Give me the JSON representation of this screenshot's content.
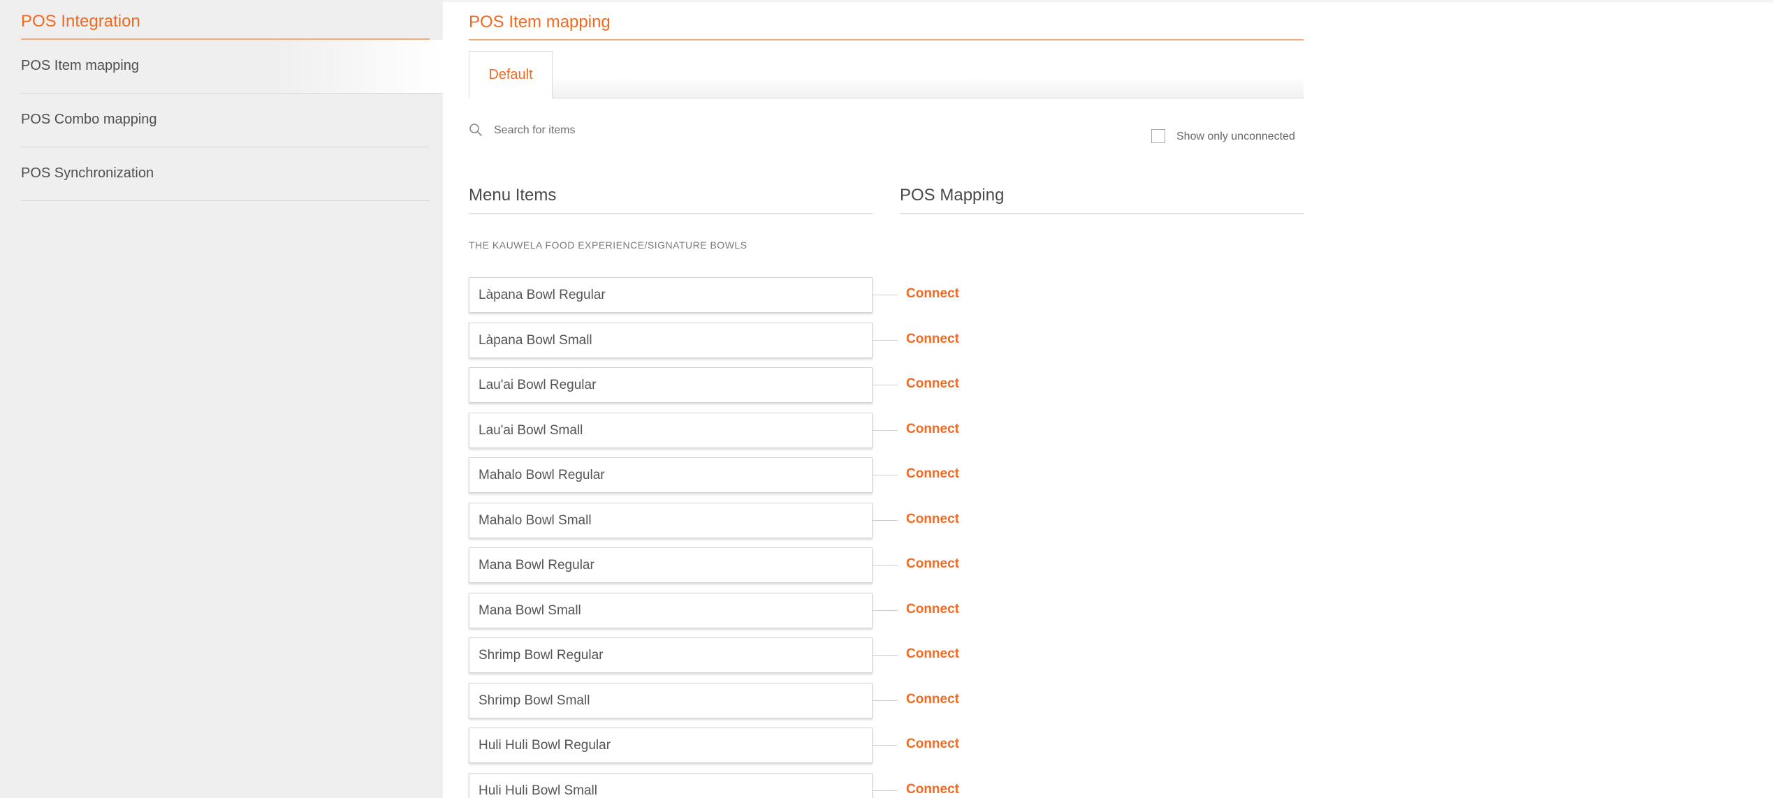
{
  "sidebar": {
    "title": "POS Integration",
    "items": [
      {
        "label": "POS Item mapping"
      },
      {
        "label": "POS Combo mapping"
      },
      {
        "label": "POS Synchronization"
      }
    ]
  },
  "main": {
    "title": "POS Item mapping",
    "tabs": [
      {
        "label": "Default"
      }
    ],
    "search": {
      "placeholder": "Search for items",
      "value": ""
    },
    "filter": {
      "label": "Show only unconnected",
      "checked": false
    },
    "columns": {
      "menu_items": "Menu Items",
      "pos_mapping": "POS Mapping"
    },
    "category": "THE KAUWELA FOOD EXPERIENCE/SIGNATURE BOWLS",
    "items": [
      {
        "name": "Làpana Bowl Regular",
        "action": "Connect"
      },
      {
        "name": "Làpana Bowl Small",
        "action": "Connect"
      },
      {
        "name": "Lau'ai Bowl Regular",
        "action": "Connect"
      },
      {
        "name": "Lau'ai Bowl Small",
        "action": "Connect"
      },
      {
        "name": "Mahalo Bowl Regular",
        "action": "Connect"
      },
      {
        "name": "Mahalo Bowl Small",
        "action": "Connect"
      },
      {
        "name": "Mana Bowl Regular",
        "action": "Connect"
      },
      {
        "name": "Mana Bowl Small",
        "action": "Connect"
      },
      {
        "name": "Shrimp Bowl Regular",
        "action": "Connect"
      },
      {
        "name": "Shrimp Bowl Small",
        "action": "Connect"
      },
      {
        "name": "Huli Huli Bowl Regular",
        "action": "Connect"
      },
      {
        "name": "Huli Huli Bowl Small",
        "action": "Connect"
      }
    ]
  },
  "colors": {
    "accent": "#f26a21",
    "sidebar_bg": "#efefef"
  },
  "icons": {
    "search": "search-icon",
    "checkbox": "checkbox-icon"
  }
}
